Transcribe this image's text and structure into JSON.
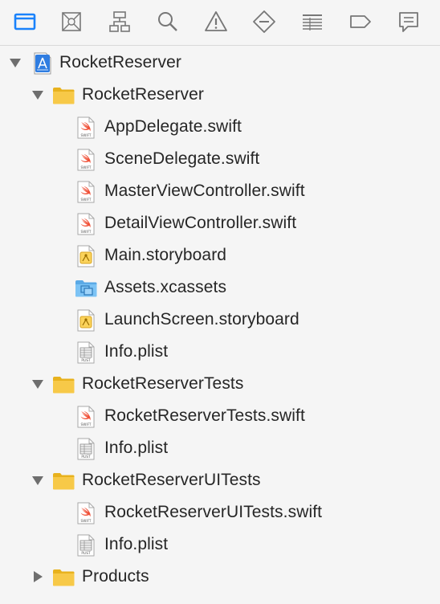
{
  "toolbar": {
    "icons": [
      {
        "name": "project-navigator-icon",
        "active": true
      },
      {
        "name": "source-control-navigator-icon",
        "active": false
      },
      {
        "name": "symbol-navigator-icon",
        "active": false
      },
      {
        "name": "find-navigator-icon",
        "active": false
      },
      {
        "name": "issue-navigator-icon",
        "active": false
      },
      {
        "name": "test-navigator-icon",
        "active": false
      },
      {
        "name": "debug-navigator-icon",
        "active": false
      },
      {
        "name": "breakpoint-navigator-icon",
        "active": false
      },
      {
        "name": "report-navigator-icon",
        "active": false
      }
    ],
    "accent": "#1a82fb"
  },
  "tree": {
    "project": {
      "label": "RocketReserver",
      "expanded": true
    },
    "groups": [
      {
        "label": "RocketReserver",
        "expanded": true,
        "files": [
          {
            "label": "AppDelegate.swift",
            "type": "swift"
          },
          {
            "label": "SceneDelegate.swift",
            "type": "swift"
          },
          {
            "label": "MasterViewController.swift",
            "type": "swift"
          },
          {
            "label": "DetailViewController.swift",
            "type": "swift"
          },
          {
            "label": "Main.storyboard",
            "type": "storyboard"
          },
          {
            "label": "Assets.xcassets",
            "type": "xcassets"
          },
          {
            "label": "LaunchScreen.storyboard",
            "type": "storyboard"
          },
          {
            "label": "Info.plist",
            "type": "plist"
          }
        ]
      },
      {
        "label": "RocketReserverTests",
        "expanded": true,
        "files": [
          {
            "label": "RocketReserverTests.swift",
            "type": "swift"
          },
          {
            "label": "Info.plist",
            "type": "plist"
          }
        ]
      },
      {
        "label": "RocketReserverUITests",
        "expanded": true,
        "files": [
          {
            "label": "RocketReserverUITests.swift",
            "type": "swift"
          },
          {
            "label": "Info.plist",
            "type": "plist"
          }
        ]
      },
      {
        "label": "Products",
        "expanded": false,
        "files": []
      }
    ]
  },
  "file_badges": {
    "swift": "SWIFT",
    "plist": "PLIST"
  },
  "colors": {
    "folder": "#f7c948",
    "swift": "#f05138",
    "text": "#262626"
  }
}
